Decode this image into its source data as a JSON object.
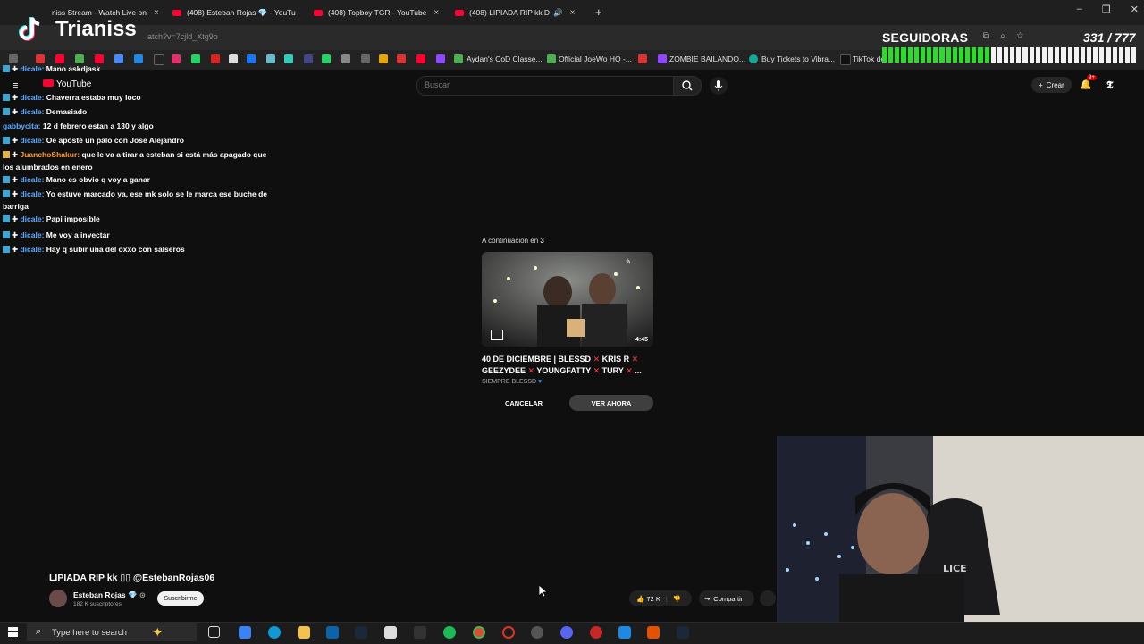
{
  "browser": {
    "tabs": [
      {
        "title": "niss Stream - Watch Live on"
      },
      {
        "title": "(408) Esteban Rojas 💎 - YouTu"
      },
      {
        "title": "(408) Topboy TGR - YouTube"
      },
      {
        "title": "(408) LIPIADA RIP kk D"
      }
    ],
    "new_tab": "+",
    "url": "atch?v=7cjld_Xtg9o",
    "bookmarks": [
      "Aydan's CoD Classe...",
      "Official JoeWo HQ -...",
      "ZOMBIE BAILANDO...",
      "Buy Tickets to Vibra...",
      "TikTok de"
    ]
  },
  "overlay": {
    "brand": "Trianiss",
    "followers_label": "SEGUIDORAS",
    "followers_count": "331 / 777",
    "progress_fraction": 0.426
  },
  "youtube": {
    "logo": "YouTube",
    "search_placeholder": "Buscar",
    "create_label": "Crear",
    "notif_badge": "9+"
  },
  "chat": [
    {
      "user": "dicale",
      "text": "Mano askdjask",
      "badge": "blue"
    },
    {
      "user": "dicale",
      "text": "Chaverra estaba muy loco",
      "badge": "blue"
    },
    {
      "user": "dicale",
      "text": "Demasiado",
      "badge": "blue"
    },
    {
      "user": "gabbycita",
      "text": "12 d febrero estan a 130 y algo",
      "badge": ""
    },
    {
      "user": "dicale",
      "text": "Oe aposté un palo con Jose Alejandro",
      "badge": "blue"
    },
    {
      "user": "JuanchoShakur",
      "text": "que le va a tirar a esteban si está más apagado que los alumbrados en enero",
      "badge": "gold"
    },
    {
      "user": "dicale",
      "text": "Mano es obvio q voy a ganar",
      "badge": "blue"
    },
    {
      "user": "dicale",
      "text": "Yo estuve marcado ya, ese mk solo se le marca ese buche de barriga",
      "badge": "blue"
    },
    {
      "user": "dicale",
      "text": "Papi imposible",
      "badge": "blue"
    },
    {
      "user": "dicale",
      "text": "Me voy a inyectar",
      "badge": "blue"
    },
    {
      "user": "dicale",
      "text": "Hay q subir una del oxxo con salseros",
      "badge": "blue"
    }
  ],
  "autoplay": {
    "up_next_label": "A continuación en",
    "countdown": "3",
    "duration": "4:45",
    "title_parts": [
      "40 DE DICIEMBRE | BLESSD",
      "KRIS R",
      "GEEZYDEE",
      "YOUNGFATTY",
      "TURY",
      "..."
    ],
    "channel": "SIEMPRE BLESSD",
    "cancel_label": "CANCELAR",
    "watch_label": "VER AHORA"
  },
  "video": {
    "title": "LIPIADA RIP kk ▯▯ @EstebanRojas06",
    "channel": "Esteban Rojas",
    "subscribers": "182 K suscriptores",
    "subscribe_label": "Suscribirme",
    "likes": "72 K",
    "share_label": "Compartir"
  },
  "taskbar": {
    "search_placeholder": "Type here to search"
  },
  "colors": {
    "youtube_red": "#ff0033",
    "progress_green": "#2bdd2b",
    "chat_user_blue": "#5cabff",
    "chat_user_orange": "#ff9a2e"
  }
}
